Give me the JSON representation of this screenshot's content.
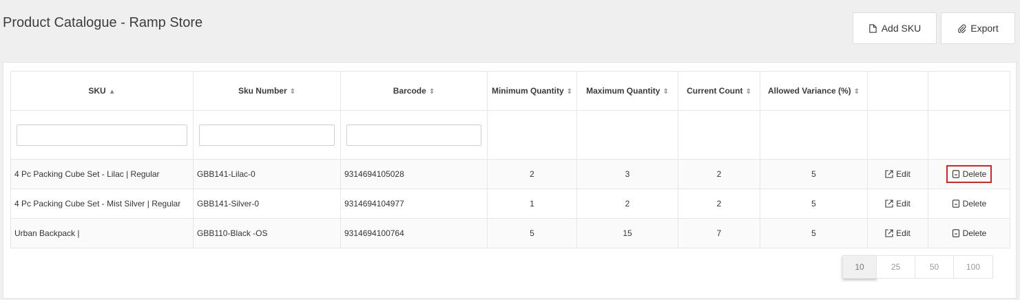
{
  "page": {
    "title": "Product Catalogue - Ramp Store"
  },
  "toolbar": {
    "add_label": "Add SKU",
    "export_label": "Export"
  },
  "table": {
    "columns": [
      {
        "label": "SKU",
        "sort": "▲"
      },
      {
        "label": "Sku Number",
        "sort": "⇕"
      },
      {
        "label": "Barcode",
        "sort": "⇕"
      },
      {
        "label": "Minimum Quantity",
        "sort": "⇕"
      },
      {
        "label": "Maximum Quantity",
        "sort": "⇕"
      },
      {
        "label": "Current Count",
        "sort": "⇕"
      },
      {
        "label": "Allowed Variance (%)",
        "sort": "⇕"
      }
    ],
    "filters": {
      "sku": "",
      "sku_number": "",
      "barcode": ""
    },
    "rows": [
      {
        "sku": "4 Pc Packing Cube Set - Lilac | Regular",
        "sku_number": "GBB141-Lilac-0",
        "barcode": "9314694105028",
        "min": "2",
        "max": "3",
        "count": "2",
        "variance": "5",
        "edit": "Edit",
        "delete": "Delete"
      },
      {
        "sku": "4 Pc Packing Cube Set - Mist Silver | Regular",
        "sku_number": "GBB141-Silver-0",
        "barcode": "9314694104977",
        "min": "1",
        "max": "2",
        "count": "2",
        "variance": "5",
        "edit": "Edit",
        "delete": "Delete"
      },
      {
        "sku": "Urban Backpack |",
        "sku_number": "GBB110-Black -OS",
        "barcode": "9314694100764",
        "min": "5",
        "max": "15",
        "count": "7",
        "variance": "5",
        "edit": "Edit",
        "delete": "Delete"
      }
    ]
  },
  "pagination": {
    "sizes": [
      "10",
      "25",
      "50",
      "100"
    ],
    "selected": "10"
  },
  "icons": {
    "add": "file-icon",
    "export": "paperclip-icon",
    "edit": "external-edit-icon",
    "delete": "document-icon"
  },
  "colors": {
    "highlight": "#dd2222"
  }
}
